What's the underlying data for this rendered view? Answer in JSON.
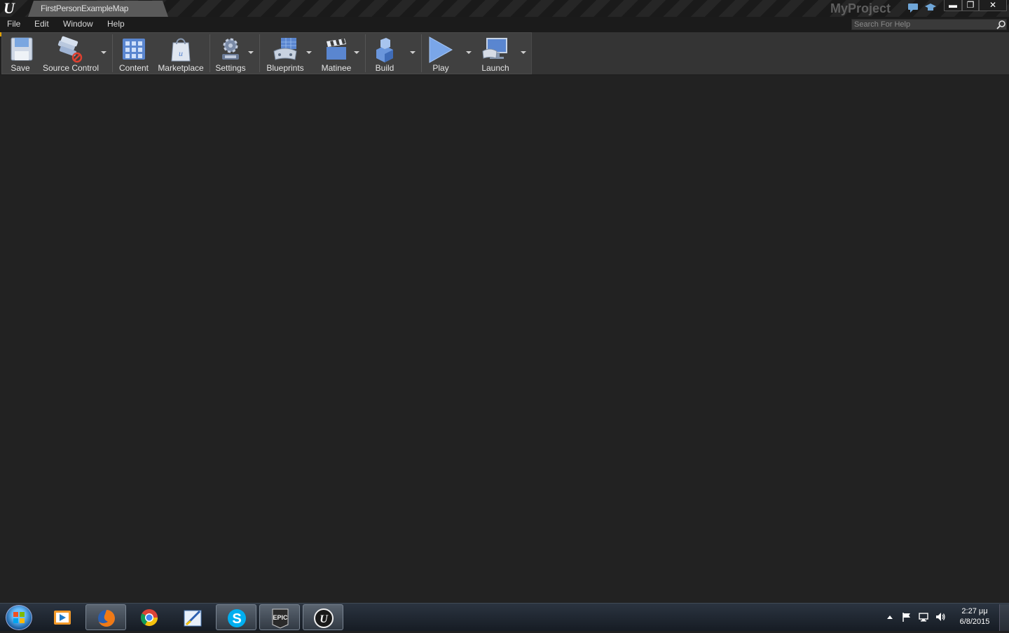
{
  "window": {
    "tab_title": "FirstPersonExampleMap",
    "project_name": "MyProject",
    "controls": {
      "minimize": "▬",
      "restore": "❐",
      "close": "✕"
    }
  },
  "menu": {
    "items": [
      "File",
      "Edit",
      "Window",
      "Help"
    ]
  },
  "help_search": {
    "placeholder": "Search For Help"
  },
  "toolbar": {
    "buttons": [
      {
        "label": "Save",
        "icon": "save-icon"
      },
      {
        "label": "Source Control",
        "icon": "source-control-icon"
      },
      {
        "label": "Content",
        "icon": "content-icon"
      },
      {
        "label": "Marketplace",
        "icon": "marketplace-icon"
      },
      {
        "label": "Settings",
        "icon": "settings-icon"
      },
      {
        "label": "Blueprints",
        "icon": "blueprints-icon"
      },
      {
        "label": "Matinee",
        "icon": "matinee-icon"
      },
      {
        "label": "Build",
        "icon": "build-icon"
      },
      {
        "label": "Play",
        "icon": "play-icon"
      },
      {
        "label": "Launch",
        "icon": "launch-icon"
      }
    ]
  },
  "taskbar": {
    "apps": [
      "media-player-icon",
      "firefox-icon",
      "chrome-icon",
      "editor-icon",
      "skype-icon",
      "epic-games-icon",
      "unreal-engine-icon"
    ],
    "clock": {
      "time": "2:27 μμ",
      "date": "6/8/2015"
    }
  },
  "colors": {
    "accent": "#e0a000",
    "background": "#222222",
    "toolbar": "#404040"
  }
}
